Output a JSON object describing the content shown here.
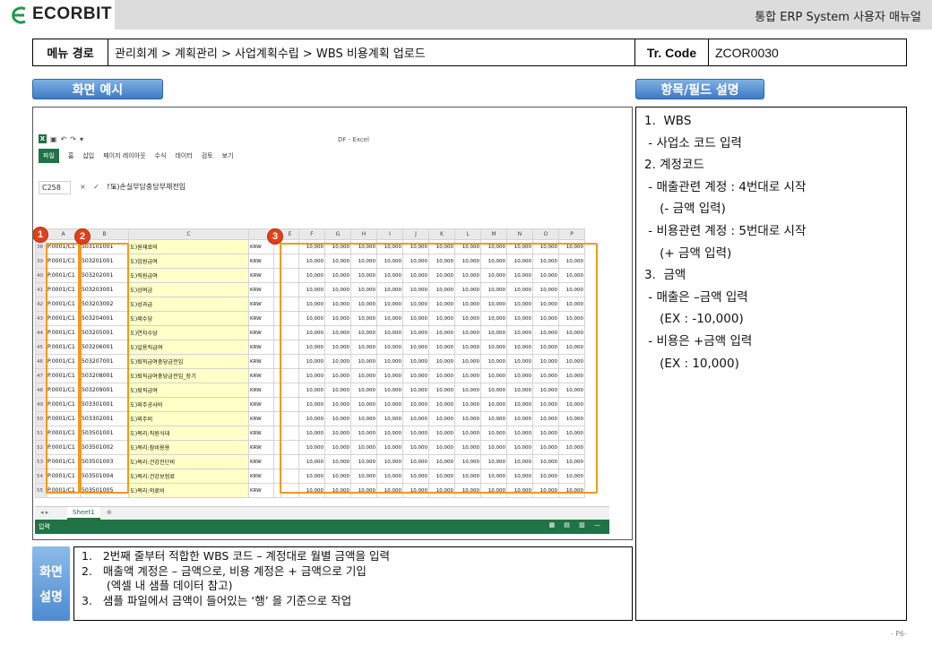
{
  "header": {
    "logo_text": "ECORBIT",
    "doc_title": "통합 ERP System 사용자 매뉴얼"
  },
  "menu_path": {
    "label": "메뉴 경로",
    "value": "관리회계 > 계획관리 > 사업계획수립 > WBS 비용계획 업로드",
    "tr_label": "Tr. Code",
    "tr_code": "ZCOR0030"
  },
  "tabs": {
    "screen_example": "화면 예시",
    "field_description": "항목/필드 설명"
  },
  "excel": {
    "file_name": "DF - Excel",
    "ribbon_tabs": [
      "파일",
      "홈",
      "삽입",
      "페이지 레이아웃",
      "수식",
      "데이터",
      "검토",
      "보기"
    ],
    "name_box": "C258",
    "formula_icons": "× ✓ fx",
    "formula_value": "도)손실부담충당부채전입",
    "column_headers": [
      "A",
      "B",
      "C",
      "",
      "",
      "E",
      "F",
      "G",
      "H",
      "I",
      "J",
      "K",
      "L",
      "M",
      "N",
      "O",
      "P"
    ],
    "rows": [
      {
        "rn": "38",
        "a": "P.0001/C1",
        "b": "503101001",
        "c": "도)원재료비",
        "d": "KRW"
      },
      {
        "rn": "39",
        "a": "P.0001/C1",
        "b": "503201001",
        "c": "도)임원급여",
        "d": "KRW"
      },
      {
        "rn": "40",
        "a": "P.0001/C1",
        "b": "503202001",
        "c": "도)직원급여",
        "d": "KRW"
      },
      {
        "rn": "41",
        "a": "P.0001/C1",
        "b": "503203001",
        "c": "도)상여금",
        "d": "KRW"
      },
      {
        "rn": "42",
        "a": "P.0001/C1",
        "b": "503203002",
        "c": "도)성과급",
        "d": "KRW"
      },
      {
        "rn": "43",
        "a": "P.0001/C1",
        "b": "503204001",
        "c": "도)제수당",
        "d": "KRW"
      },
      {
        "rn": "44",
        "a": "P.0001/C1",
        "b": "503205001",
        "c": "도)연차수당",
        "d": "KRW"
      },
      {
        "rn": "45",
        "a": "P.0001/C1",
        "b": "503206001",
        "c": "도)일용직급여",
        "d": "KRW"
      },
      {
        "rn": "46",
        "a": "P.0001/C1",
        "b": "503207001",
        "c": "도)퇴직급여충당금전입",
        "d": "KRW"
      },
      {
        "rn": "47",
        "a": "P.0001/C1",
        "b": "503208001",
        "c": "도)퇴직급여충당금전입_장기",
        "d": "KRW"
      },
      {
        "rn": "48",
        "a": "P.0001/C1",
        "b": "503209001",
        "c": "도)퇴직급여",
        "d": "KRW"
      },
      {
        "rn": "49",
        "a": "P.0001/C1",
        "b": "503301001",
        "c": "도)외주공사비",
        "d": "KRW"
      },
      {
        "rn": "50",
        "a": "P.0001/C1",
        "b": "503302001",
        "c": "도)외주비",
        "d": "KRW"
      },
      {
        "rn": "51",
        "a": "P.0001/C1",
        "b": "503501001",
        "c": "도)복리:직원식대",
        "d": "KRW"
      },
      {
        "rn": "52",
        "a": "P.0001/C1",
        "b": "503501002",
        "c": "도)복리:참비용용",
        "d": "KRW"
      },
      {
        "rn": "53",
        "a": "P.0001/C1",
        "b": "503501003",
        "c": "도)복리:건강진단비",
        "d": "KRW"
      },
      {
        "rn": "54",
        "a": "P.0001/C1",
        "b": "503501004",
        "c": "도)복리:건강보험료",
        "d": "KRW"
      },
      {
        "rn": "55",
        "a": "P.0001/C1",
        "b": "503501005",
        "c": "도)복리:의료비",
        "d": "KRW"
      }
    ],
    "amount_value": "10,000",
    "sheet_tab": "Sheet1",
    "status_text": "입력"
  },
  "badges": [
    "1",
    "2",
    "3"
  ],
  "field_description": [
    "1.  WBS",
    " - 사업소 코드 입력",
    "2. 계정코드",
    " - 매출관련 계정 : 4번대로 시작",
    "    (- 금액 입력)",
    " - 비용관련 계정 : 5번대로 시작",
    "    (+ 금액 입력)",
    "3.  금액",
    " - 매출은 –금액 입력",
    "    (EX : -10,000)",
    " - 비용은 +금액 입력",
    "    (EX : 10,000)"
  ],
  "explanation": {
    "label_1": "화면",
    "label_2": "설명",
    "lines": [
      "1.   2번째 줄부터 적합한 WBS 코드 – 계정대로 월별 금액을 입력",
      "2.   매출액 계정은 – 금액으로, 비용 계정은 + 금액으로 기입",
      "       (엑셀 내 샘플 데이터 참고)",
      "3.   샘플 파일에서 금액이 들어있는 ‘행’ 을 기준으로 작업"
    ]
  },
  "page_number": "- P6-",
  "colors": {
    "highlight": "#f29a1c",
    "badge": "#e0401a",
    "tab_blue": "#3d7bc6",
    "excel_green": "#217346"
  }
}
